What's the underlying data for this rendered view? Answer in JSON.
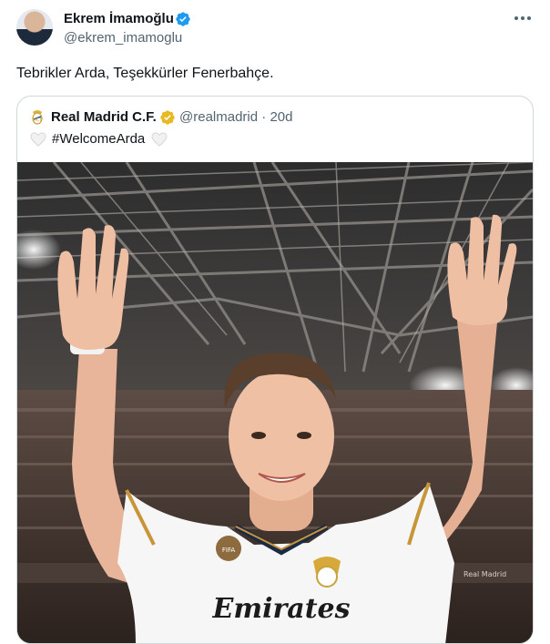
{
  "author": {
    "name": "Ekrem İmamoğlu",
    "handle": "@ekrem_imamoglu",
    "avatar_icon": "avatar-photo",
    "verified_color": "#1d9bf0"
  },
  "tweet": {
    "text": "Tebrikler Arda, Teşekkürler Fenerbahçe."
  },
  "quoted": {
    "name": "Real Madrid C.F.",
    "handle": "@realmadrid",
    "separator": "·",
    "time": "20d",
    "text": "#WelcomeArda",
    "verified_color": "#e8b923",
    "logo_icon": "real-madrid-crest-icon",
    "image": {
      "kit_sponsor": "Emirates",
      "stadium_board": "Real Madrid"
    }
  },
  "colors": {
    "secondary_text": "#536471",
    "border": "#cfd9de"
  }
}
